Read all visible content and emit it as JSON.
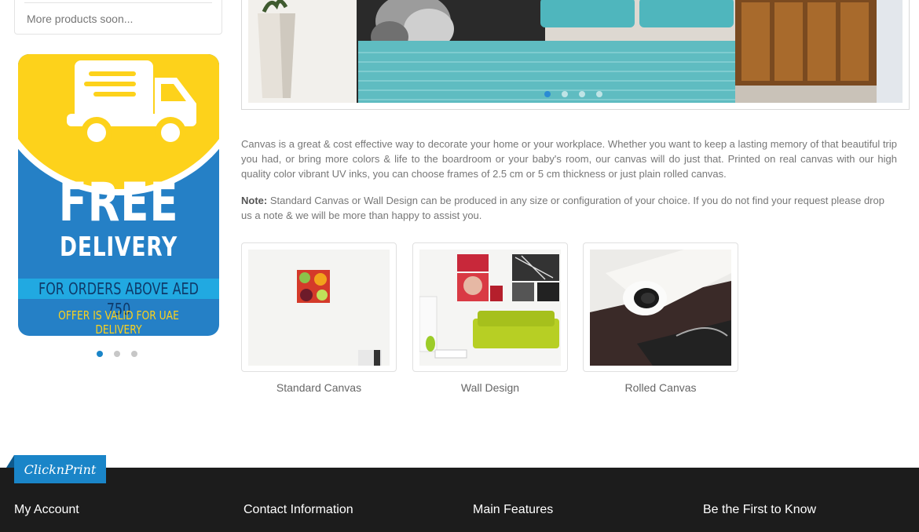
{
  "sidebar": {
    "more_products": "More products soon...",
    "promo": {
      "line1": "FREE",
      "line2": "DELIVERY",
      "line3": "FOR ORDERS ABOVE AED 750",
      "line4": "OFFER IS VALID FOR UAE DELIVERY"
    },
    "slider_dots": 3,
    "active_dot": 0
  },
  "banner": {
    "slider_dots": 4,
    "active_dot": 0
  },
  "content": {
    "description": "Canvas is a great & cost effective way to decorate your home or your workplace. Whether you want to keep a lasting memory of that beautiful trip you had, or bring more colors & life to the boardroom or your baby's room, our canvas will do just that. Printed on real canvas with our high quality color vibrant UV inks, you can choose frames of 2.5 cm or 5 cm thickness or just plain rolled canvas.",
    "note_label": "Note:",
    "note_text": " Standard Canvas or Wall Design can be produced in any size or configuration of your choice. If you do not find your request please drop us a note & we will be more than happy to assist you."
  },
  "products": [
    {
      "label": "Standard Canvas"
    },
    {
      "label": "Wall Design"
    },
    {
      "label": "Rolled Canvas"
    }
  ],
  "footer": {
    "brand": "ClicknPrint",
    "columns": [
      "My Account",
      "Contact Information",
      "Main Features",
      "Be the First to Know"
    ]
  },
  "colors": {
    "accent": "#1a85c8",
    "promo_blue": "#2580c6",
    "promo_yellow": "#fdd21b",
    "footer_bg": "#1c1c1c"
  }
}
